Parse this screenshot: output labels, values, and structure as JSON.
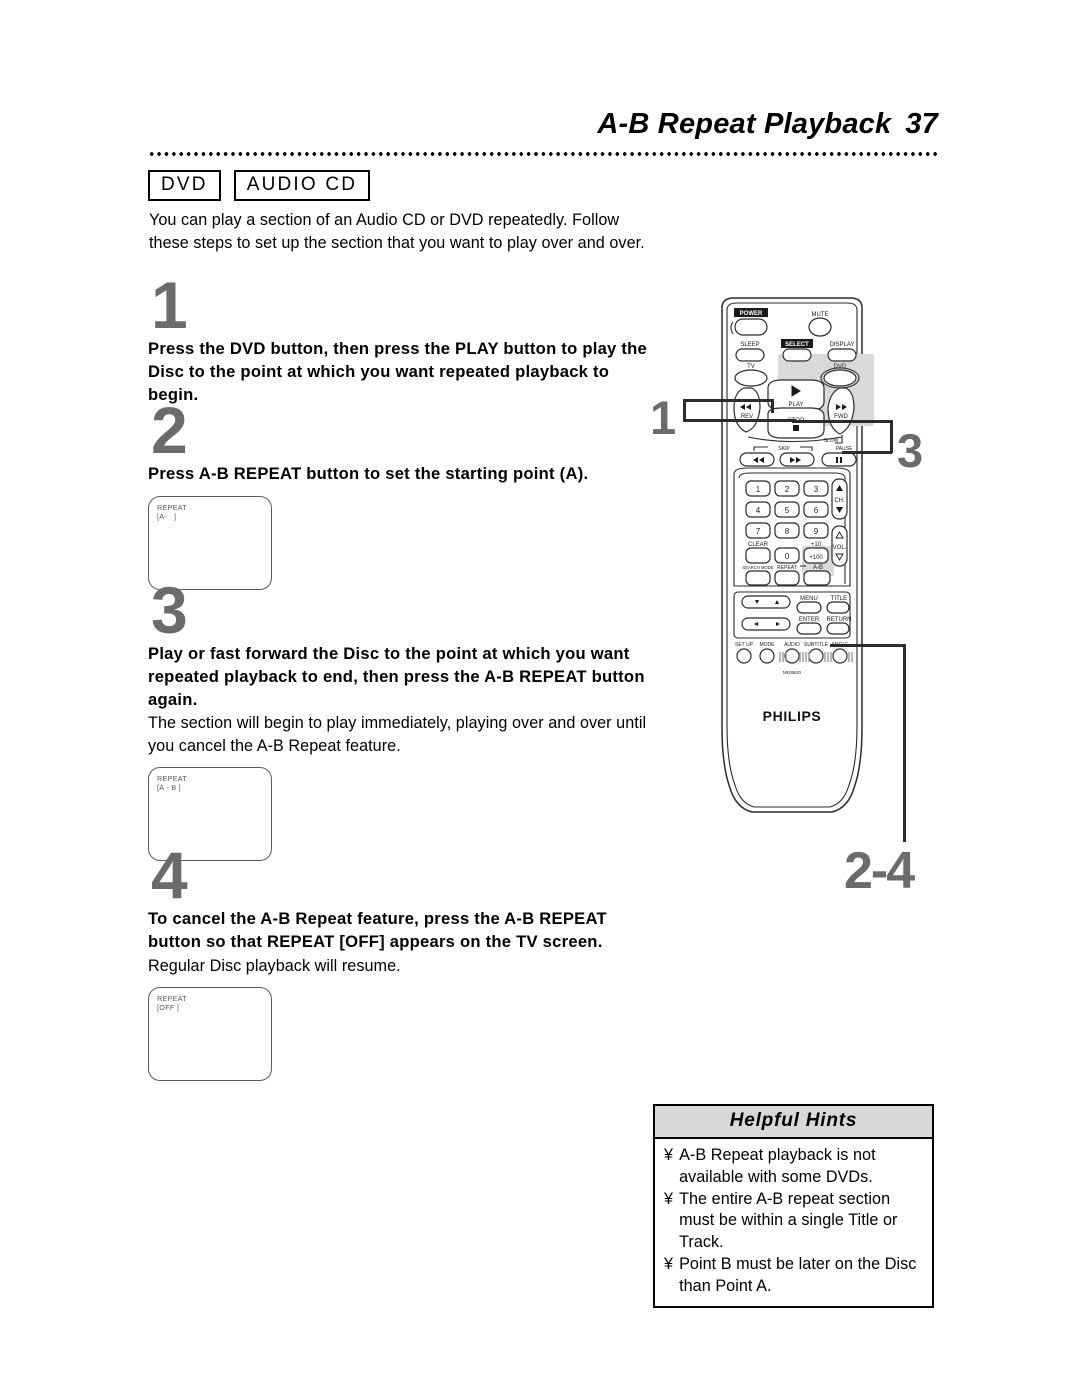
{
  "header": {
    "title": "A-B Repeat Playback",
    "page_number": "37"
  },
  "disc_badges": [
    {
      "label": "DVD"
    },
    {
      "label": "AUDIO CD"
    }
  ],
  "intro": "You can play a section of an Audio CD or DVD repeatedly. Follow these steps to set up the section that you want to play over and over.",
  "steps": [
    {
      "number": "1",
      "heading": "Press the DVD button, then press the PLAY button to play the Disc to the point at which you want repeated playback to begin."
    },
    {
      "number": "2",
      "heading": "Press A-B REPEAT button to set the starting point (A).",
      "screen": {
        "line1": "REPEAT",
        "line2": "[A-   ]"
      }
    },
    {
      "number": "3",
      "heading": "Play or fast forward the Disc to the point at which you want repeated playback to end, then press the A-B REPEAT button again.",
      "body": "The section will begin to play immediately, playing over and over until you cancel the A-B Repeat feature.",
      "screen": {
        "line1": "REPEAT",
        "line2": "[A - B ]"
      }
    },
    {
      "number": "4",
      "heading": "To cancel the A-B Repeat feature, press the A-B REPEAT button so that REPEAT [OFF] appears on the TV screen.",
      "body": "Regular Disc playback will resume.",
      "screen": {
        "line1": "REPEAT",
        "line2": "[OFF ]"
      }
    }
  ],
  "callouts": [
    {
      "id": "callout-1",
      "label": "1"
    },
    {
      "id": "callout-3",
      "label": "3"
    },
    {
      "id": "callout-2-4",
      "label": "2-4"
    }
  ],
  "remote": {
    "brand": "PHILIPS",
    "model_code": "N9286UD",
    "buttons": {
      "power": "POWER",
      "mute": "MUTE",
      "sleep": "SLEEP",
      "select": "SELECT",
      "display": "DISPLAY",
      "tv": "TV",
      "dvd": "DVD",
      "play": "PLAY",
      "rev": "REV",
      "fwd": "FWD",
      "stop": "STOP",
      "skip": "SKIP",
      "slow": "SLOW",
      "pause": "PAUSE",
      "clear": "CLEAR",
      "plus_ten": "+10",
      "plus_hundred": "+100",
      "zero": "0",
      "search_mode": "SEARCH MODE",
      "repeat": "REPEAT",
      "ab": "A-B",
      "ch": "CH.",
      "vol": "VOL.",
      "menu": "MENU",
      "title": "TITLE",
      "enter": "ENTER",
      "return": "RETURN",
      "set_up": "SET UP",
      "mode": "MODE",
      "audio": "AUDIO",
      "subtitle": "SUBTITLE",
      "angle": "ANGLE",
      "numbers": [
        "1",
        "2",
        "3",
        "4",
        "5",
        "6",
        "7",
        "8",
        "9"
      ]
    }
  },
  "helpful_hints": {
    "title": "Helpful Hints",
    "bullet": "¥",
    "items": [
      "A-B Repeat playback is not available with some DVDs.",
      "The entire A-B repeat section must be within a single Title or Track.",
      "Point B must be later on the Disc than Point A."
    ]
  },
  "colors": {
    "step_number": "#6b6b6b",
    "hints_header_bg": "#d8d8d8",
    "highlight": "#d9d9d9"
  }
}
